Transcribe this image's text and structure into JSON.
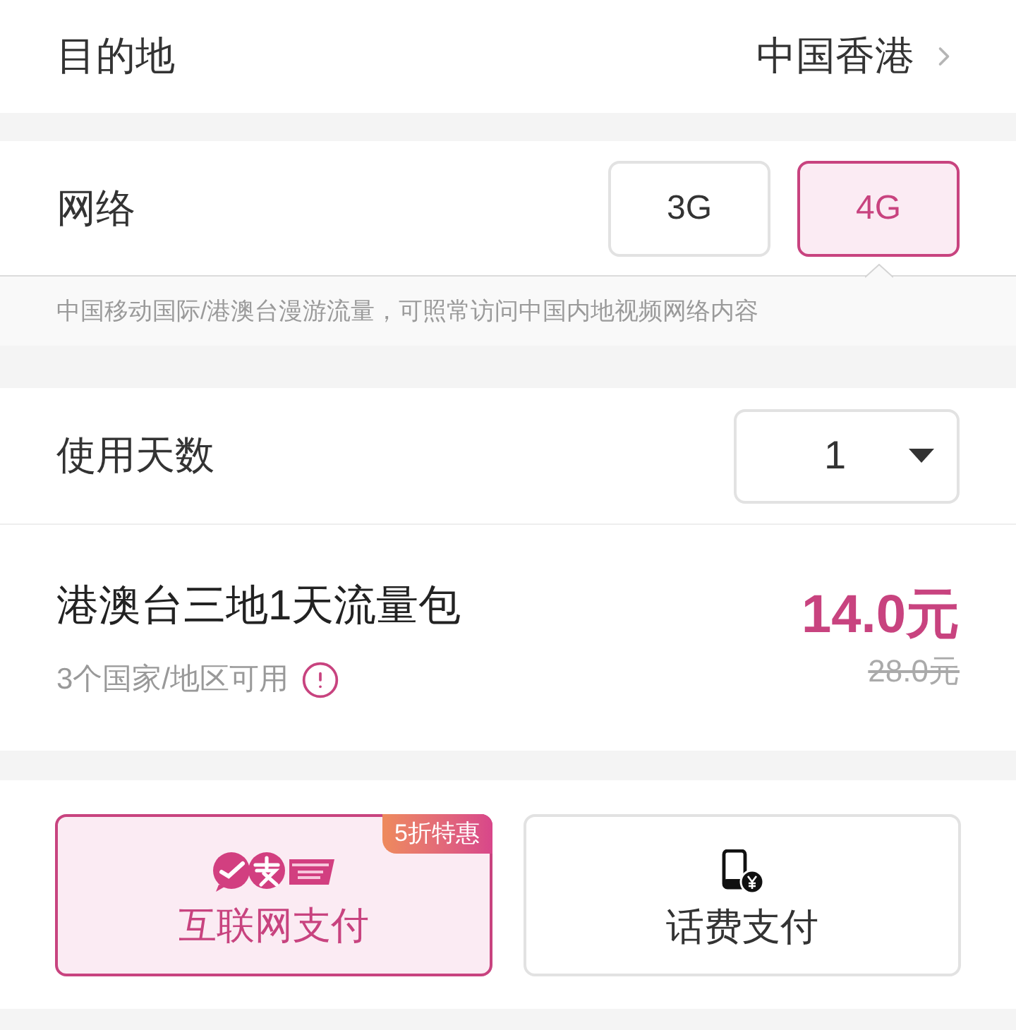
{
  "destination": {
    "label": "目的地",
    "value": "中国香港"
  },
  "network": {
    "label": "网络",
    "options": [
      {
        "label": "3G",
        "selected": false
      },
      {
        "label": "4G",
        "selected": true
      }
    ],
    "note": "中国移动国际/港澳台漫游流量，可照常访问中国内地视频网络内容"
  },
  "days": {
    "label": "使用天数",
    "value": "1"
  },
  "package": {
    "title": "港澳台三地1天流量包",
    "coverage": "3个国家/地区可用",
    "price": "14.0元",
    "original_price": "28.0元"
  },
  "payment_methods": [
    {
      "kind": "online",
      "label": "互联网支付",
      "badge": "5折特惠",
      "selected": true
    },
    {
      "kind": "phone_bill",
      "label": "话费支付",
      "selected": false
    }
  ]
}
